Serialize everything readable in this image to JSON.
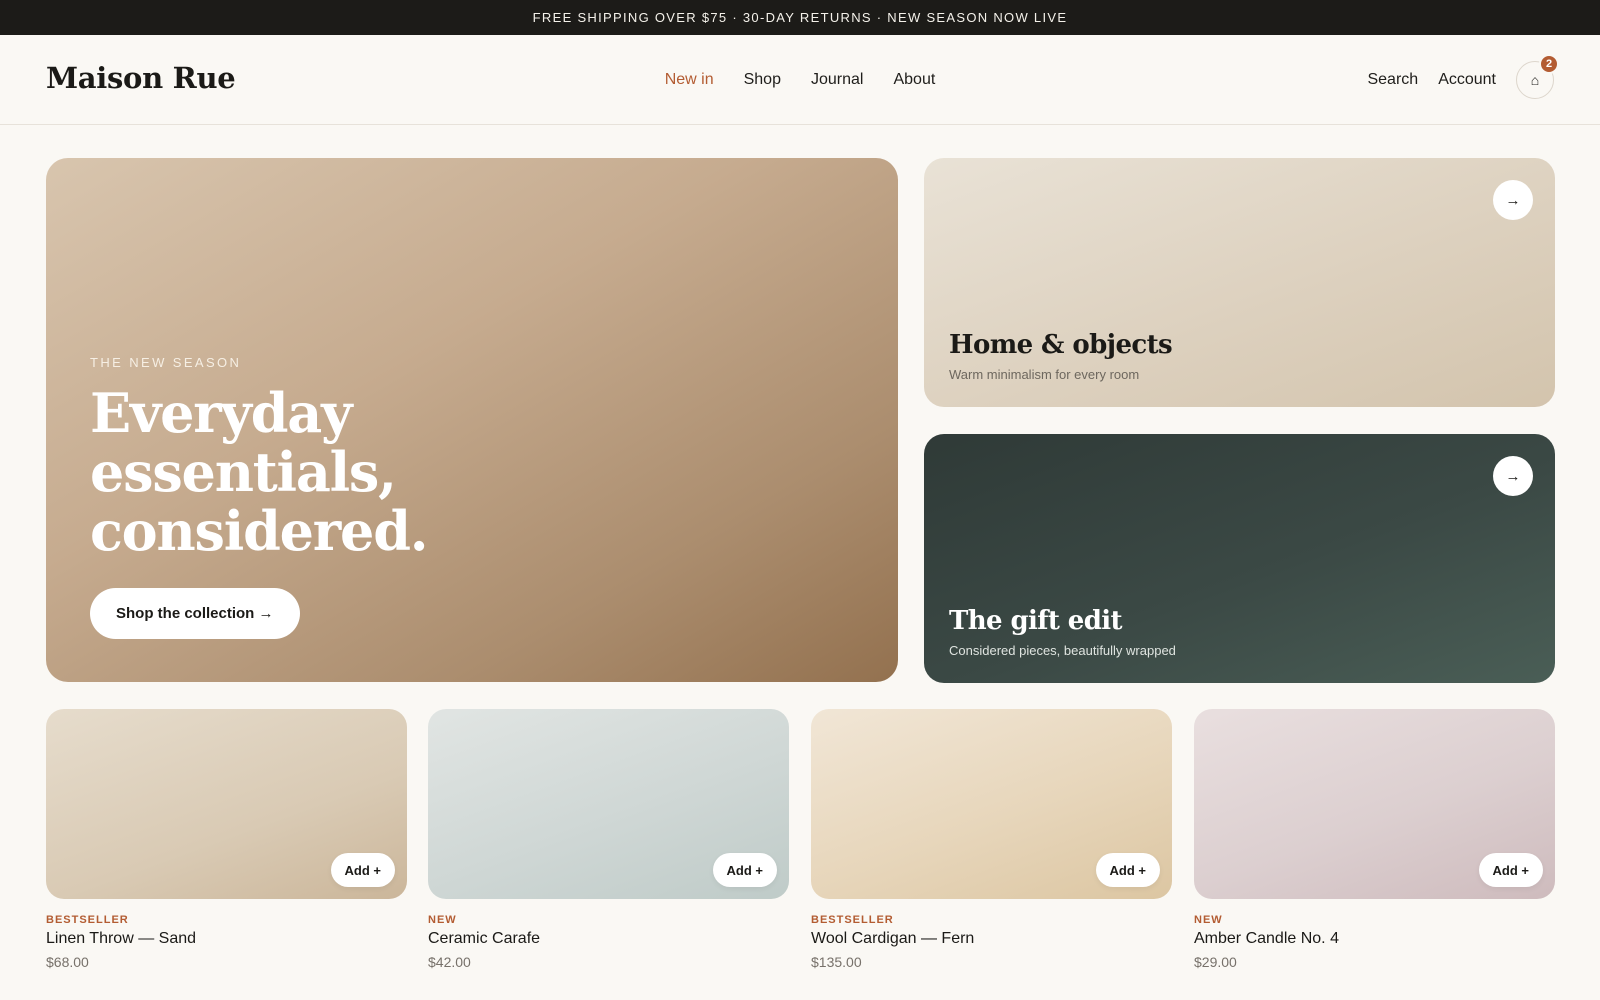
{
  "announcement": "FREE SHIPPING OVER $75 · 30-DAY RETURNS · NEW SEASON NOW LIVE",
  "header": {
    "logo": "Maison Rue",
    "nav": [
      "New in",
      "Shop",
      "Journal",
      "About"
    ],
    "active_nav": "New in",
    "search_label": "Search",
    "account_label": "Account",
    "cart_icon": "bag-icon",
    "cart_glyph": "⌂",
    "cart_count": "2"
  },
  "hero": {
    "eyebrow": "THE NEW SEASON",
    "title_lines": [
      "Everyday",
      "essentials,",
      "considered."
    ],
    "cta": "Shop the collection →"
  },
  "tiles": [
    {
      "title": "Home & objects",
      "subtitle": "Warm minimalism for every room",
      "arrow": "→"
    },
    {
      "title": "The gift edit",
      "subtitle": "Considered pieces, beautifully wrapped",
      "arrow": "→"
    }
  ],
  "products": [
    {
      "badge": "BESTSELLER",
      "name": "Linen Throw — Sand",
      "price": "$68.00",
      "add_label": "Add +"
    },
    {
      "badge": "NEW",
      "name": "Ceramic Carafe",
      "price": "$42.00",
      "add_label": "Add +"
    },
    {
      "badge": "BESTSELLER",
      "name": "Wool Cardigan — Fern",
      "price": "$135.00",
      "add_label": "Add +"
    },
    {
      "badge": "NEW",
      "name": "Amber Candle No. 4",
      "price": "$29.00",
      "add_label": "Add +"
    }
  ],
  "colors": {
    "accent": "#b35c32",
    "announcement_bg": "#1c1b18",
    "page_bg": "#faf8f4",
    "gift_tile_bg": "#3b4945"
  }
}
